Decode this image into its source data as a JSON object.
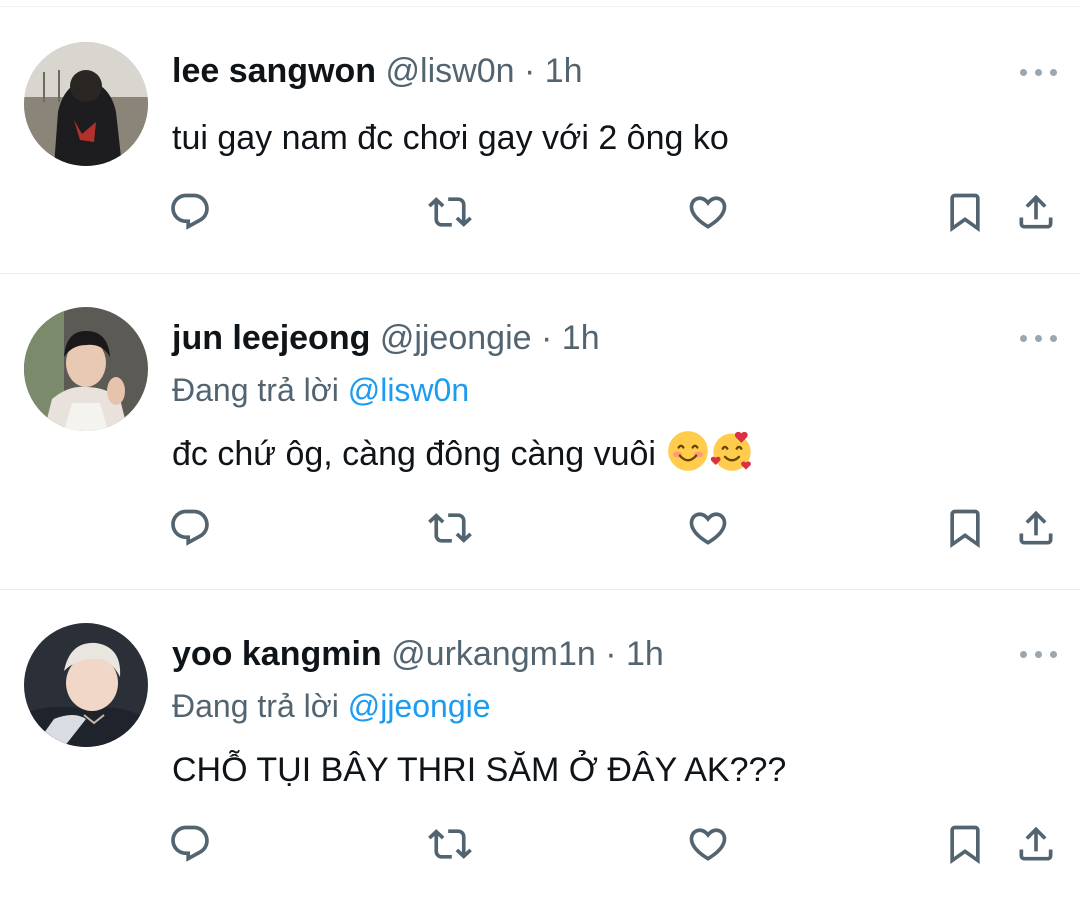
{
  "tweets": [
    {
      "name": "lee sangwon",
      "handle": "@lisw0n",
      "separator": "·",
      "time": "1h",
      "reply_prefix": "",
      "reply_mention": "",
      "text": "tui gay nam đc chơi gay với 2 ông ko",
      "emojis": []
    },
    {
      "name": "jun leejeong",
      "handle": "@jjeongie",
      "separator": "·",
      "time": "1h",
      "reply_prefix": "Đang trả lời ",
      "reply_mention": "@lisw0n",
      "text": "đc chứ ôg, càng đông càng vuôi ",
      "emojis": [
        "smiling-face-emoji",
        "smiling-face-with-hearts-emoji"
      ]
    },
    {
      "name": "yoo kangmin",
      "handle": "@urkangm1n",
      "separator": "·",
      "time": "1h",
      "reply_prefix": "Đang trả lời ",
      "reply_mention": "@jjeongie",
      "text": "CHỖ TỤI BÂY THRI SĂM Ở ĐÂY AK???",
      "emojis": []
    }
  ],
  "actions": [
    "reply-icon",
    "retweet-icon",
    "like-icon",
    "bookmark-icon",
    "share-icon"
  ],
  "colors": {
    "text": "#0f1419",
    "secondary": "#536471",
    "link": "#1d9bf0",
    "divider": "#e6ecf0"
  }
}
